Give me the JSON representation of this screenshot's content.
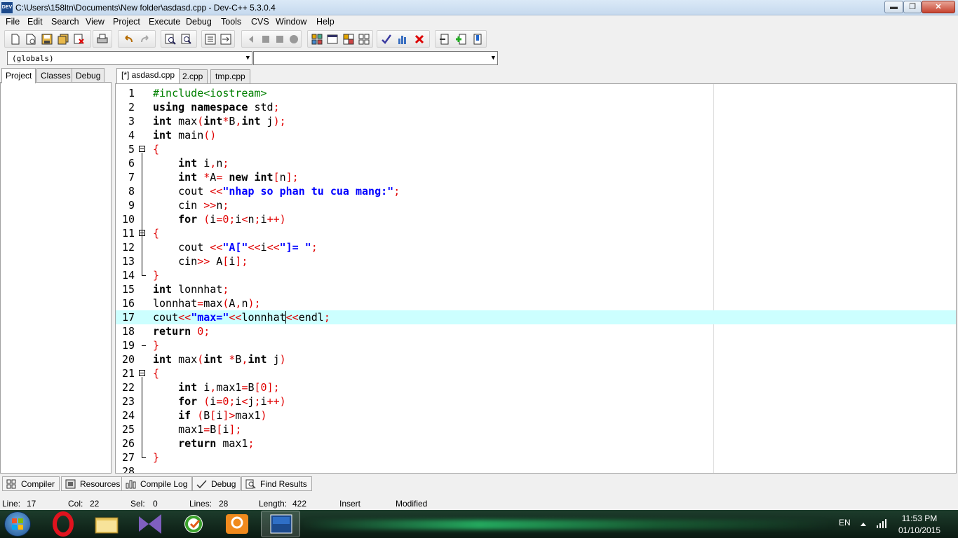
{
  "window": {
    "title": "C:\\Users\\158ltn\\Documents\\New folder\\asdasd.cpp - Dev-C++ 5.3.0.4",
    "app_icon": "DEV",
    "min_label": "▬",
    "max_label": "❐",
    "close_label": "✕"
  },
  "menu": [
    "File",
    "Edit",
    "Search",
    "View",
    "Project",
    "Execute",
    "Debug",
    "Tools",
    "CVS",
    "Window",
    "Help"
  ],
  "selectors": {
    "scope": "(globals)",
    "symbol": ""
  },
  "left_tabs": [
    "Project",
    "Classes",
    "Debug"
  ],
  "editor_tabs": [
    "[*] asdasd.cpp",
    "2.cpp",
    "tmp.cpp"
  ],
  "code_lines": [
    {
      "n": "1",
      "tokens": [
        {
          "t": "#include<iostream>",
          "c": "pp"
        }
      ]
    },
    {
      "n": "2",
      "tokens": [
        {
          "t": "using namespace",
          "c": "k"
        },
        {
          "t": " std",
          "c": "i"
        },
        {
          "t": ";",
          "c": "p"
        }
      ]
    },
    {
      "n": "3",
      "tokens": [
        {
          "t": "int",
          "c": "k"
        },
        {
          "t": " max",
          "c": "i"
        },
        {
          "t": "(",
          "c": "p"
        },
        {
          "t": "int",
          "c": "k"
        },
        {
          "t": "*",
          "c": "p"
        },
        {
          "t": "B",
          "c": "i"
        },
        {
          "t": ",",
          "c": "p"
        },
        {
          "t": "int",
          "c": "k"
        },
        {
          "t": " j",
          "c": "i"
        },
        {
          "t": ");",
          "c": "p"
        }
      ]
    },
    {
      "n": "4",
      "tokens": [
        {
          "t": "int",
          "c": "k"
        },
        {
          "t": " main",
          "c": "i"
        },
        {
          "t": "()",
          "c": "p"
        }
      ]
    },
    {
      "n": "5",
      "fold": "open",
      "tokens": [
        {
          "t": "{",
          "c": "p"
        }
      ]
    },
    {
      "n": "6",
      "tokens": [
        {
          "t": "    ",
          "c": "i"
        },
        {
          "t": "int",
          "c": "k"
        },
        {
          "t": " i",
          "c": "i"
        },
        {
          "t": ",",
          "c": "p"
        },
        {
          "t": "n",
          "c": "i"
        },
        {
          "t": ";",
          "c": "p"
        }
      ]
    },
    {
      "n": "7",
      "tokens": [
        {
          "t": "    ",
          "c": "i"
        },
        {
          "t": "int",
          "c": "k"
        },
        {
          "t": " ",
          "c": "i"
        },
        {
          "t": "*",
          "c": "p"
        },
        {
          "t": "A",
          "c": "i"
        },
        {
          "t": "=",
          "c": "p"
        },
        {
          "t": " ",
          "c": "i"
        },
        {
          "t": "new int",
          "c": "k"
        },
        {
          "t": "[",
          "c": "p"
        },
        {
          "t": "n",
          "c": "i"
        },
        {
          "t": "];",
          "c": "p"
        }
      ]
    },
    {
      "n": "8",
      "tokens": [
        {
          "t": "    cout ",
          "c": "i"
        },
        {
          "t": "<<",
          "c": "p"
        },
        {
          "t": "\"nhap so phan tu cua mang:\"",
          "c": "s"
        },
        {
          "t": ";",
          "c": "p"
        }
      ]
    },
    {
      "n": "9",
      "tokens": [
        {
          "t": "    cin ",
          "c": "i"
        },
        {
          "t": ">>",
          "c": "p"
        },
        {
          "t": "n",
          "c": "i"
        },
        {
          "t": ";",
          "c": "p"
        }
      ]
    },
    {
      "n": "10",
      "tokens": [
        {
          "t": "    ",
          "c": "i"
        },
        {
          "t": "for",
          "c": "k"
        },
        {
          "t": " ",
          "c": "i"
        },
        {
          "t": "(",
          "c": "p"
        },
        {
          "t": "i",
          "c": "i"
        },
        {
          "t": "=",
          "c": "p"
        },
        {
          "t": "0",
          "c": "n"
        },
        {
          "t": ";",
          "c": "p"
        },
        {
          "t": "i",
          "c": "i"
        },
        {
          "t": "<",
          "c": "p"
        },
        {
          "t": "n",
          "c": "i"
        },
        {
          "t": ";",
          "c": "p"
        },
        {
          "t": "i",
          "c": "i"
        },
        {
          "t": "++)",
          "c": "p"
        }
      ]
    },
    {
      "n": "11",
      "fold": "open",
      "tokens": [
        {
          "t": "{",
          "c": "p"
        }
      ]
    },
    {
      "n": "12",
      "tokens": [
        {
          "t": "    cout ",
          "c": "i"
        },
        {
          "t": "<<",
          "c": "p"
        },
        {
          "t": "\"A[\"",
          "c": "s"
        },
        {
          "t": "<<",
          "c": "p"
        },
        {
          "t": "i",
          "c": "i"
        },
        {
          "t": "<<",
          "c": "p"
        },
        {
          "t": "\"]= \"",
          "c": "s"
        },
        {
          "t": ";",
          "c": "p"
        }
      ]
    },
    {
      "n": "13",
      "tokens": [
        {
          "t": "    cin",
          "c": "i"
        },
        {
          "t": ">>",
          "c": "p"
        },
        {
          "t": " A",
          "c": "i"
        },
        {
          "t": "[",
          "c": "p"
        },
        {
          "t": "i",
          "c": "i"
        },
        {
          "t": "];",
          "c": "p"
        }
      ]
    },
    {
      "n": "14",
      "fold": "end",
      "tokens": [
        {
          "t": "}",
          "c": "p"
        }
      ]
    },
    {
      "n": "15",
      "tokens": [
        {
          "t": "int",
          "c": "k"
        },
        {
          "t": " lonnhat",
          "c": "i"
        },
        {
          "t": ";",
          "c": "p"
        }
      ]
    },
    {
      "n": "16",
      "tokens": [
        {
          "t": "lonnhat",
          "c": "i"
        },
        {
          "t": "=",
          "c": "p"
        },
        {
          "t": "max",
          "c": "i"
        },
        {
          "t": "(",
          "c": "p"
        },
        {
          "t": "A",
          "c": "i"
        },
        {
          "t": ",",
          "c": "p"
        },
        {
          "t": "n",
          "c": "i"
        },
        {
          "t": ");",
          "c": "p"
        }
      ]
    },
    {
      "n": "17",
      "current": true,
      "tokens": [
        {
          "t": "cout",
          "c": "i"
        },
        {
          "t": "<<",
          "c": "p"
        },
        {
          "t": "\"max=\"",
          "c": "s"
        },
        {
          "t": "<<",
          "c": "p"
        },
        {
          "t": "lonnhat",
          "c": "i"
        },
        {
          "t": "<<",
          "c": "p"
        },
        {
          "t": "endl",
          "c": "i"
        },
        {
          "t": ";",
          "c": "p"
        }
      ]
    },
    {
      "n": "18",
      "tokens": [
        {
          "t": "return",
          "c": "k"
        },
        {
          "t": " ",
          "c": "i"
        },
        {
          "t": "0",
          "c": "n"
        },
        {
          "t": ";",
          "c": "p"
        }
      ]
    },
    {
      "n": "19",
      "fold": "end",
      "tokens": [
        {
          "t": "}",
          "c": "p"
        }
      ]
    },
    {
      "n": "20",
      "tokens": [
        {
          "t": "int",
          "c": "k"
        },
        {
          "t": " max",
          "c": "i"
        },
        {
          "t": "(",
          "c": "p"
        },
        {
          "t": "int",
          "c": "k"
        },
        {
          "t": " ",
          "c": "i"
        },
        {
          "t": "*",
          "c": "p"
        },
        {
          "t": "B",
          "c": "i"
        },
        {
          "t": ",",
          "c": "p"
        },
        {
          "t": "int",
          "c": "k"
        },
        {
          "t": " j",
          "c": "i"
        },
        {
          "t": ")",
          "c": "p"
        }
      ]
    },
    {
      "n": "21",
      "fold": "open",
      "tokens": [
        {
          "t": "{",
          "c": "p"
        }
      ]
    },
    {
      "n": "22",
      "tokens": [
        {
          "t": "    ",
          "c": "i"
        },
        {
          "t": "int",
          "c": "k"
        },
        {
          "t": " i",
          "c": "i"
        },
        {
          "t": ",",
          "c": "p"
        },
        {
          "t": "max1",
          "c": "i"
        },
        {
          "t": "=",
          "c": "p"
        },
        {
          "t": "B",
          "c": "i"
        },
        {
          "t": "[",
          "c": "p"
        },
        {
          "t": "0",
          "c": "n"
        },
        {
          "t": "];",
          "c": "p"
        }
      ]
    },
    {
      "n": "23",
      "tokens": [
        {
          "t": "    ",
          "c": "i"
        },
        {
          "t": "for",
          "c": "k"
        },
        {
          "t": " ",
          "c": "i"
        },
        {
          "t": "(",
          "c": "p"
        },
        {
          "t": "i",
          "c": "i"
        },
        {
          "t": "=",
          "c": "p"
        },
        {
          "t": "0",
          "c": "n"
        },
        {
          "t": ";",
          "c": "p"
        },
        {
          "t": "i",
          "c": "i"
        },
        {
          "t": "<",
          "c": "p"
        },
        {
          "t": "j",
          "c": "i"
        },
        {
          "t": ";",
          "c": "p"
        },
        {
          "t": "i",
          "c": "i"
        },
        {
          "t": "++)",
          "c": "p"
        }
      ]
    },
    {
      "n": "24",
      "tokens": [
        {
          "t": "    ",
          "c": "i"
        },
        {
          "t": "if",
          "c": "k"
        },
        {
          "t": " ",
          "c": "i"
        },
        {
          "t": "(",
          "c": "p"
        },
        {
          "t": "B",
          "c": "i"
        },
        {
          "t": "[",
          "c": "p"
        },
        {
          "t": "i",
          "c": "i"
        },
        {
          "t": "]>",
          "c": "p"
        },
        {
          "t": "max1",
          "c": "i"
        },
        {
          "t": ")",
          "c": "p"
        }
      ]
    },
    {
      "n": "25",
      "tokens": [
        {
          "t": "    max1",
          "c": "i"
        },
        {
          "t": "=",
          "c": "p"
        },
        {
          "t": "B",
          "c": "i"
        },
        {
          "t": "[",
          "c": "p"
        },
        {
          "t": "i",
          "c": "i"
        },
        {
          "t": "];",
          "c": "p"
        }
      ]
    },
    {
      "n": "26",
      "tokens": [
        {
          "t": "    ",
          "c": "i"
        },
        {
          "t": "return",
          "c": "k"
        },
        {
          "t": " max1",
          "c": "i"
        },
        {
          "t": ";",
          "c": "p"
        }
      ]
    },
    {
      "n": "27",
      "fold": "end",
      "tokens": [
        {
          "t": "}",
          "c": "p"
        }
      ]
    },
    {
      "n": "28",
      "tokens": []
    }
  ],
  "bottom_tabs": [
    {
      "label": "Compiler",
      "icon": "grid-icon"
    },
    {
      "label": "Resources",
      "icon": "resources-icon"
    },
    {
      "label": "Compile Log",
      "icon": "chart-icon"
    },
    {
      "label": "Debug",
      "icon": "check-icon"
    },
    {
      "label": "Find Results",
      "icon": "find-icon"
    }
  ],
  "status": {
    "line_label": "Line:",
    "line": "17",
    "col_label": "Col:",
    "col": "22",
    "sel_label": "Sel:",
    "sel": "0",
    "lines_label": "Lines:",
    "lines": "28",
    "length_label": "Length:",
    "length": "422",
    "mode": "Insert",
    "state": "Modified"
  },
  "taskbar": {
    "lang": "EN",
    "time": "11:53 PM",
    "date": "01/10/2015",
    "apps": [
      "start-orb",
      "opera-icon",
      "explorer-icon",
      "visual-studio-icon",
      "codeblocks-icon",
      "pdf-icon",
      "devcpp-icon"
    ]
  },
  "colors": {
    "keyword": "#000000",
    "string": "#0000ff",
    "symbol": "#e00000",
    "preprocessor": "#008000",
    "current_line": "#ccffff"
  }
}
